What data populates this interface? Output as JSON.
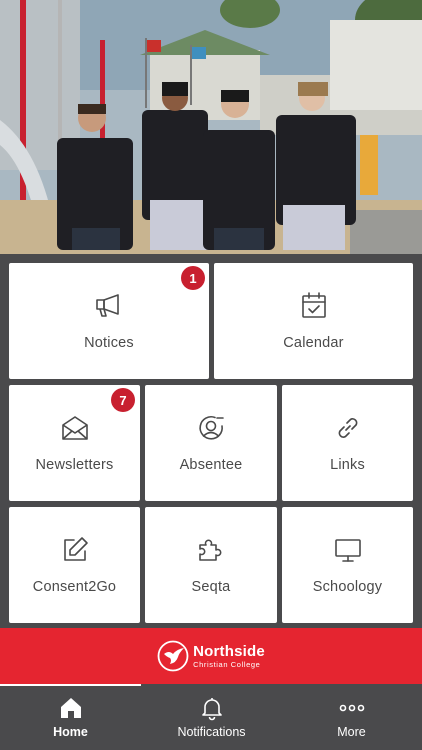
{
  "tiles": {
    "notices": {
      "label": "Notices",
      "badge": "1",
      "icon": "megaphone-icon"
    },
    "calendar": {
      "label": "Calendar",
      "icon": "calendar-check-icon"
    },
    "newsletters": {
      "label": "Newsletters",
      "badge": "7",
      "icon": "envelope-open-icon"
    },
    "absentee": {
      "label": "Absentee",
      "icon": "user-minus-icon"
    },
    "links": {
      "label": "Links",
      "icon": "link-icon"
    },
    "consent2go": {
      "label": "Consent2Go",
      "icon": "edit-icon"
    },
    "seqta": {
      "label": "Seqta",
      "icon": "puzzle-icon"
    },
    "schoology": {
      "label": "Schoology",
      "icon": "monitor-icon"
    }
  },
  "brand": {
    "name": "Northside",
    "subtitle": "Christian College"
  },
  "tabbar": {
    "home": {
      "label": "Home",
      "icon": "home-icon",
      "active": true
    },
    "notifications": {
      "label": "Notifications",
      "icon": "bell-icon"
    },
    "more": {
      "label": "More",
      "icon": "more-dots-icon"
    }
  },
  "colors": {
    "brand_red": "#e52530",
    "badge_red": "#c8202f",
    "background_gray": "#4a4a4c",
    "tile_white": "#ffffff"
  }
}
